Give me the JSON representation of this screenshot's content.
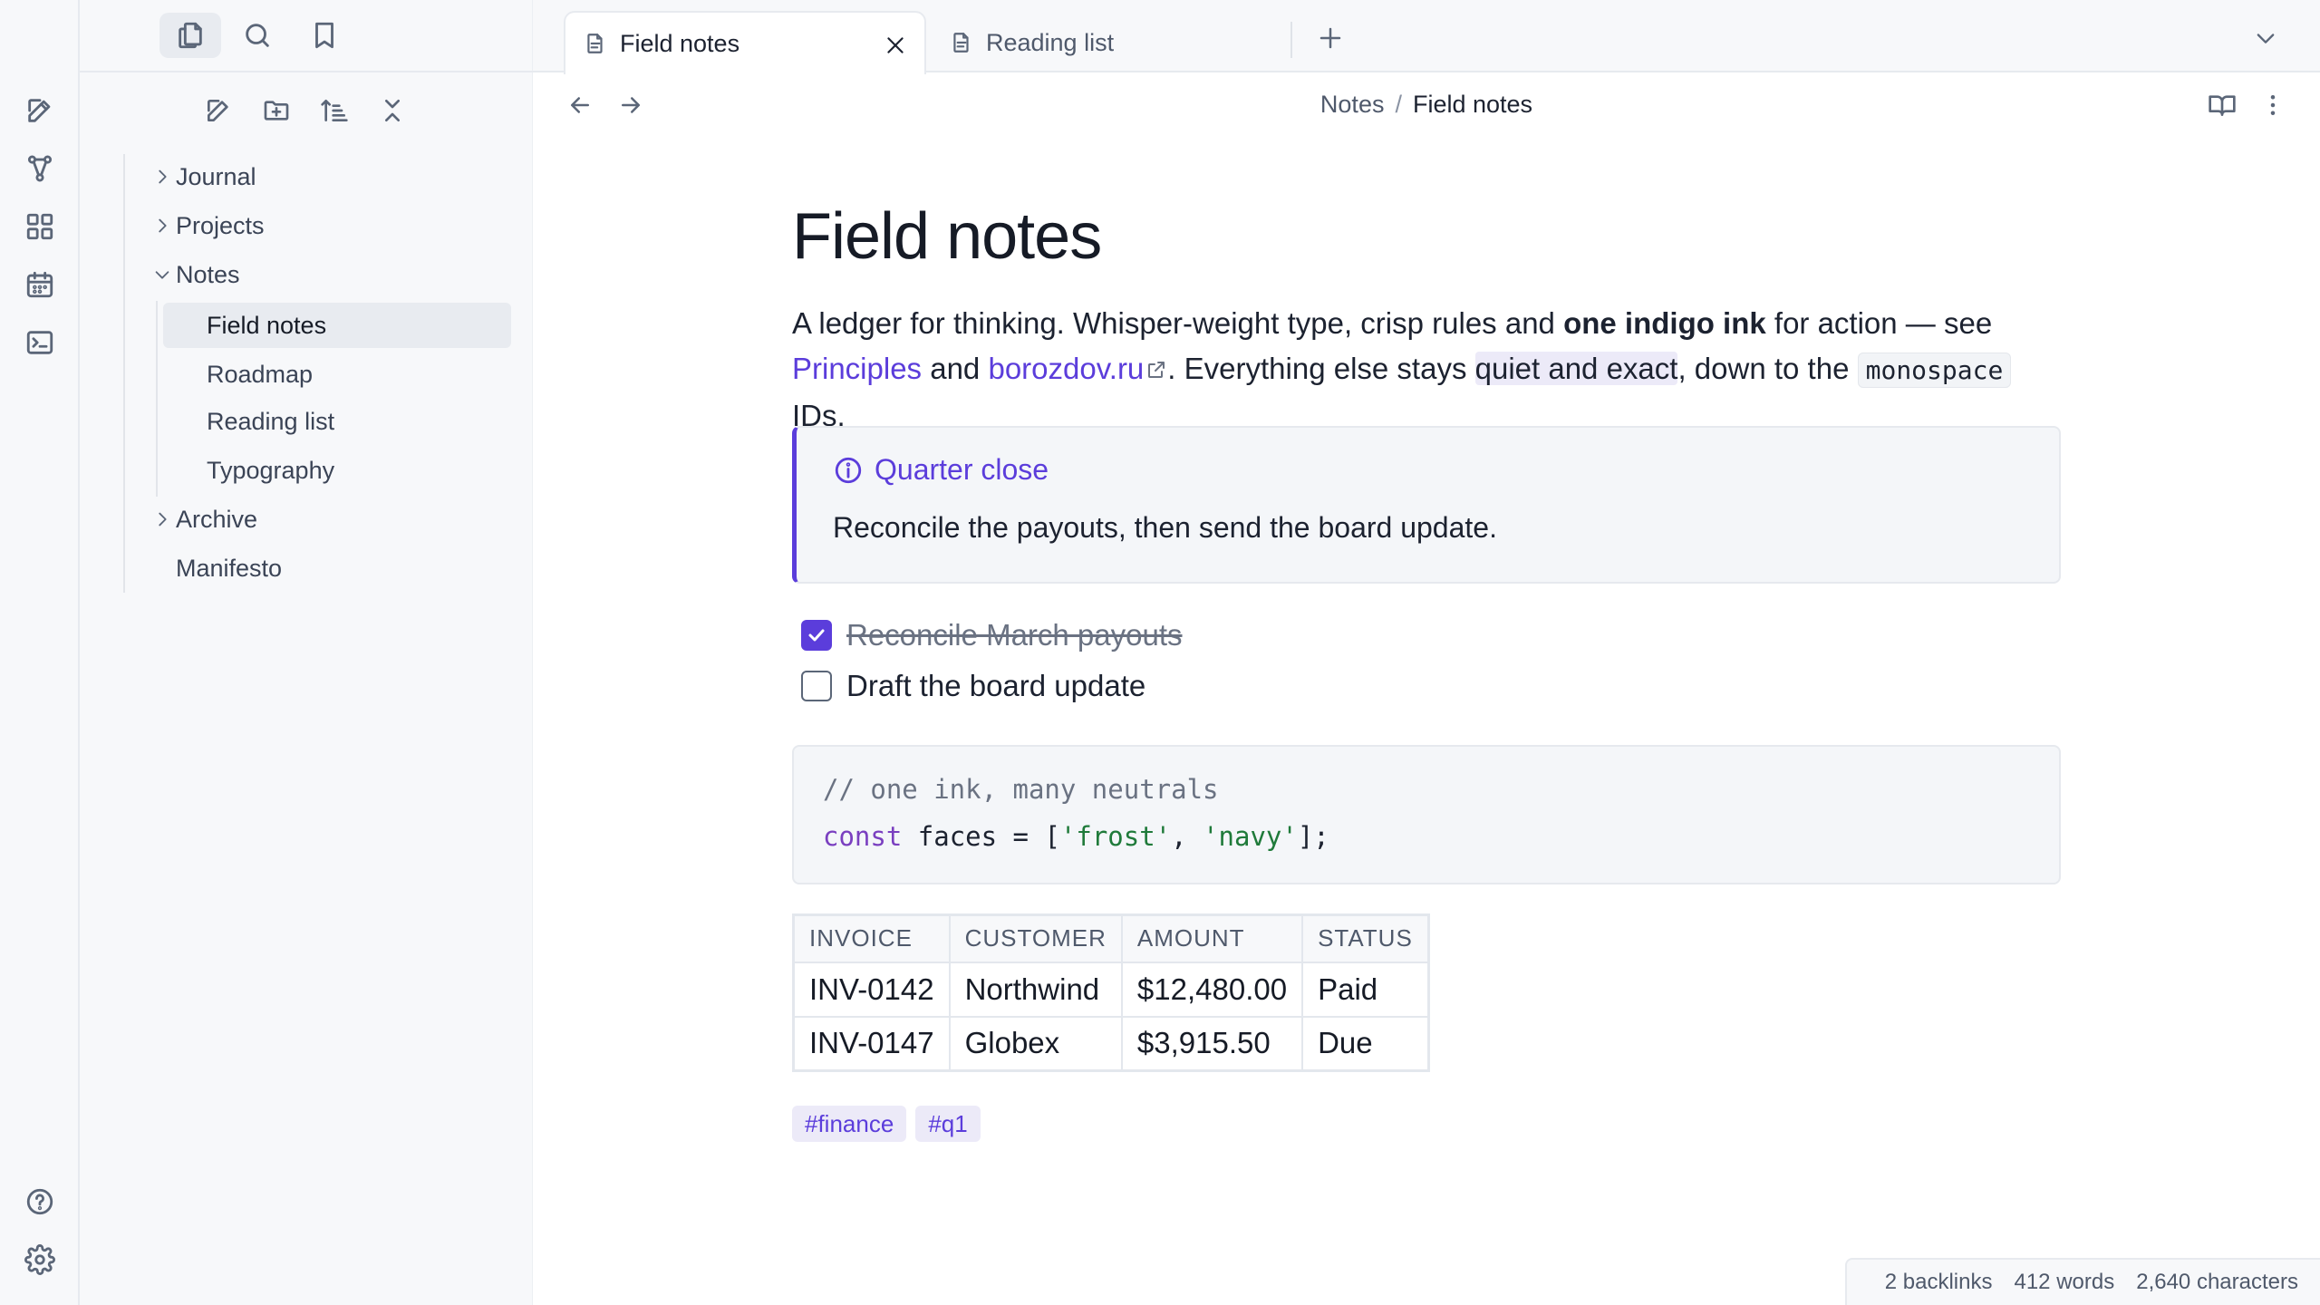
{
  "sidebar": {
    "nav_tabs": [
      {
        "icon": "files-icon",
        "active": true
      },
      {
        "icon": "search-icon",
        "active": false
      },
      {
        "icon": "bookmark-icon",
        "active": false
      }
    ],
    "toolbar_icons": [
      "new-note-icon",
      "new-folder-icon",
      "sort-icon",
      "collapse-all-icon"
    ],
    "tree": {
      "folders": [
        {
          "label": "Journal",
          "expanded": false
        },
        {
          "label": "Projects",
          "expanded": false
        },
        {
          "label": "Notes",
          "expanded": true,
          "children": [
            "Field notes",
            "Roadmap",
            "Reading list",
            "Typography"
          ],
          "selected_child": "Field notes"
        },
        {
          "label": "Archive",
          "expanded": false
        }
      ],
      "files": [
        "Manifesto"
      ]
    }
  },
  "ribbon": {
    "top_icons": [
      "edit-icon",
      "graph-icon",
      "canvas-icon",
      "calendar-icon",
      "terminal-icon"
    ],
    "bottom_icons": [
      "help-icon",
      "settings-icon"
    ]
  },
  "tabs": [
    {
      "label": "Field notes",
      "active": true
    },
    {
      "label": "Reading list",
      "active": false
    }
  ],
  "breadcrumb": {
    "parent": "Notes",
    "separator": "/",
    "current": "Field notes"
  },
  "document": {
    "title": "Field notes",
    "paragraph": {
      "p1": "A ledger for thinking. Whisper-weight type, crisp rules and ",
      "bold": "one indigo ink",
      "p2": " for action — see ",
      "link1": "Principles",
      "p3": " and ",
      "link2": "borozdov.ru",
      "p4": ". Everything else stays ",
      "highlight": "quiet and exact",
      "p5": ", down to the ",
      "code": "monospace",
      "p6": " IDs."
    },
    "callout": {
      "title": "Quarter close",
      "body": "Reconcile the payouts, then send the board update."
    },
    "tasks": [
      {
        "label": "Reconcile March payouts",
        "done": true
      },
      {
        "label": "Draft the board update",
        "done": false
      }
    ],
    "code": {
      "comment": "// one ink, many neutrals",
      "kw": "const",
      "ident": " faces = [",
      "s1": "'frost'",
      "comma": ", ",
      "s2": "'navy'",
      "end": "];"
    },
    "table": {
      "headers": [
        "INVOICE",
        "CUSTOMER",
        "AMOUNT",
        "STATUS"
      ],
      "rows": [
        [
          "INV-0142",
          "Northwind",
          "$12,480.00",
          "Paid"
        ],
        [
          "INV-0147",
          "Globex",
          "$3,915.50",
          "Due"
        ]
      ]
    },
    "tags": [
      "#finance",
      "#q1"
    ]
  },
  "status": {
    "backlinks": "2 backlinks",
    "words": "412 words",
    "characters": "2,640 characters"
  },
  "colors": {
    "accent": "#5b3ddb",
    "text": "#1c2230",
    "muted": "#4f596b",
    "panel": "#f7f8fa"
  }
}
